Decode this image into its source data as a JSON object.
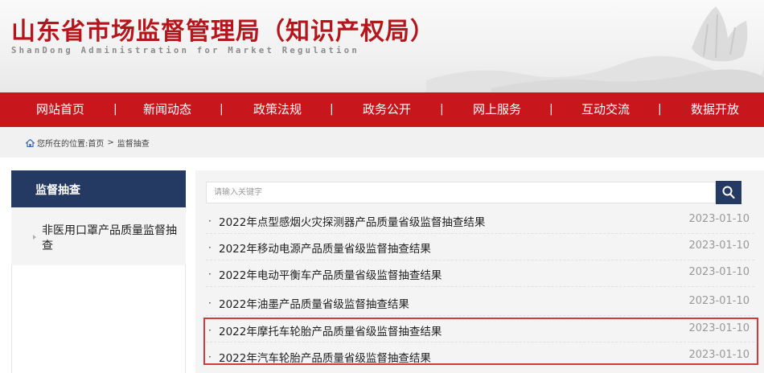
{
  "header": {
    "title": "山东省市场监督管理局（知识产权局）",
    "subtitle": "ShanDong Administration for Market Regulation"
  },
  "nav": {
    "items": [
      "网站首页",
      "新闻动态",
      "政策法规",
      "政务公开",
      "网上服务",
      "互动交流",
      "数据开放"
    ],
    "separator": "|"
  },
  "breadcrumb": {
    "prefix": "您所在的位置: ",
    "home": "首页",
    "arrow": ">",
    "current": "监督抽查"
  },
  "sidebar": {
    "heading": "监督抽查",
    "items": [
      {
        "label": "非医用口罩产品质量监督抽查"
      }
    ]
  },
  "search": {
    "placeholder": "请输入关键字",
    "icon": "search-icon"
  },
  "list": {
    "bullet": "·",
    "items": [
      {
        "title": "2022年点型感烟火灾探测器产品质量省级监督抽查结果",
        "date": "2023-01-10"
      },
      {
        "title": "2022年移动电源产品质量省级监督抽查结果",
        "date": "2023-01-10"
      },
      {
        "title": "2022年电动平衡车产品质量省级监督抽查结果",
        "date": "2023-01-10"
      },
      {
        "title": "2022年油墨产品质量省级监督抽查结果",
        "date": "2023-01-10"
      },
      {
        "title": "2022年摩托车轮胎产品质量省级监督抽查结果",
        "date": "2023-01-10"
      },
      {
        "title": "2022年汽车轮胎产品质量省级监督抽查结果",
        "date": "2023-01-10"
      }
    ]
  },
  "colors": {
    "brand_red": "#c8161d",
    "navy": "#243a63",
    "highlight": "#d43a3a"
  }
}
